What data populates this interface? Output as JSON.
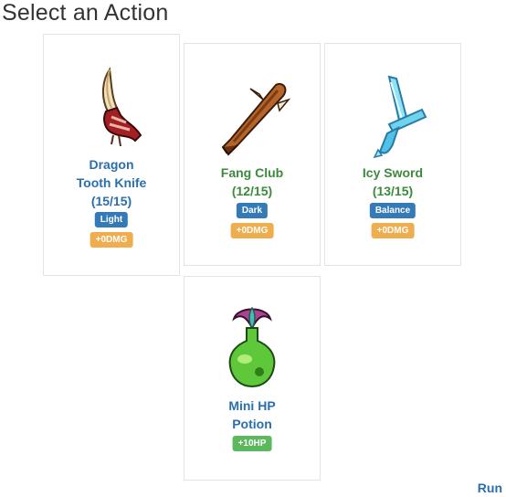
{
  "header": {
    "title": "Select an Action"
  },
  "colors": {
    "blue_text": "#2a6fad",
    "green_text": "#3c8a3c",
    "light_badge": "#337ab7",
    "dmg_badge": "#f0ad4e",
    "hp_badge": "#5cb85c"
  },
  "cards": [
    {
      "name_line1": "Dragon",
      "name_line2": "Tooth Knife",
      "uses": "(15/15)",
      "type": "Light",
      "bonus": "+0DMG",
      "icon": "dragon-tooth-knife-icon"
    },
    {
      "name_line1": "Fang Club",
      "uses": "(12/15)",
      "type": "Dark",
      "bonus": "+0DMG",
      "icon": "fang-club-icon"
    },
    {
      "name_line1": "Icy Sword",
      "uses": "(13/15)",
      "type": "Balance",
      "bonus": "+0DMG",
      "icon": "icy-sword-icon"
    },
    {
      "name_line1": "Mini HP",
      "name_line2": "Potion",
      "bonus": "+10HP",
      "icon": "mini-hp-potion-icon"
    }
  ],
  "footer": {
    "run_label": "Run"
  }
}
